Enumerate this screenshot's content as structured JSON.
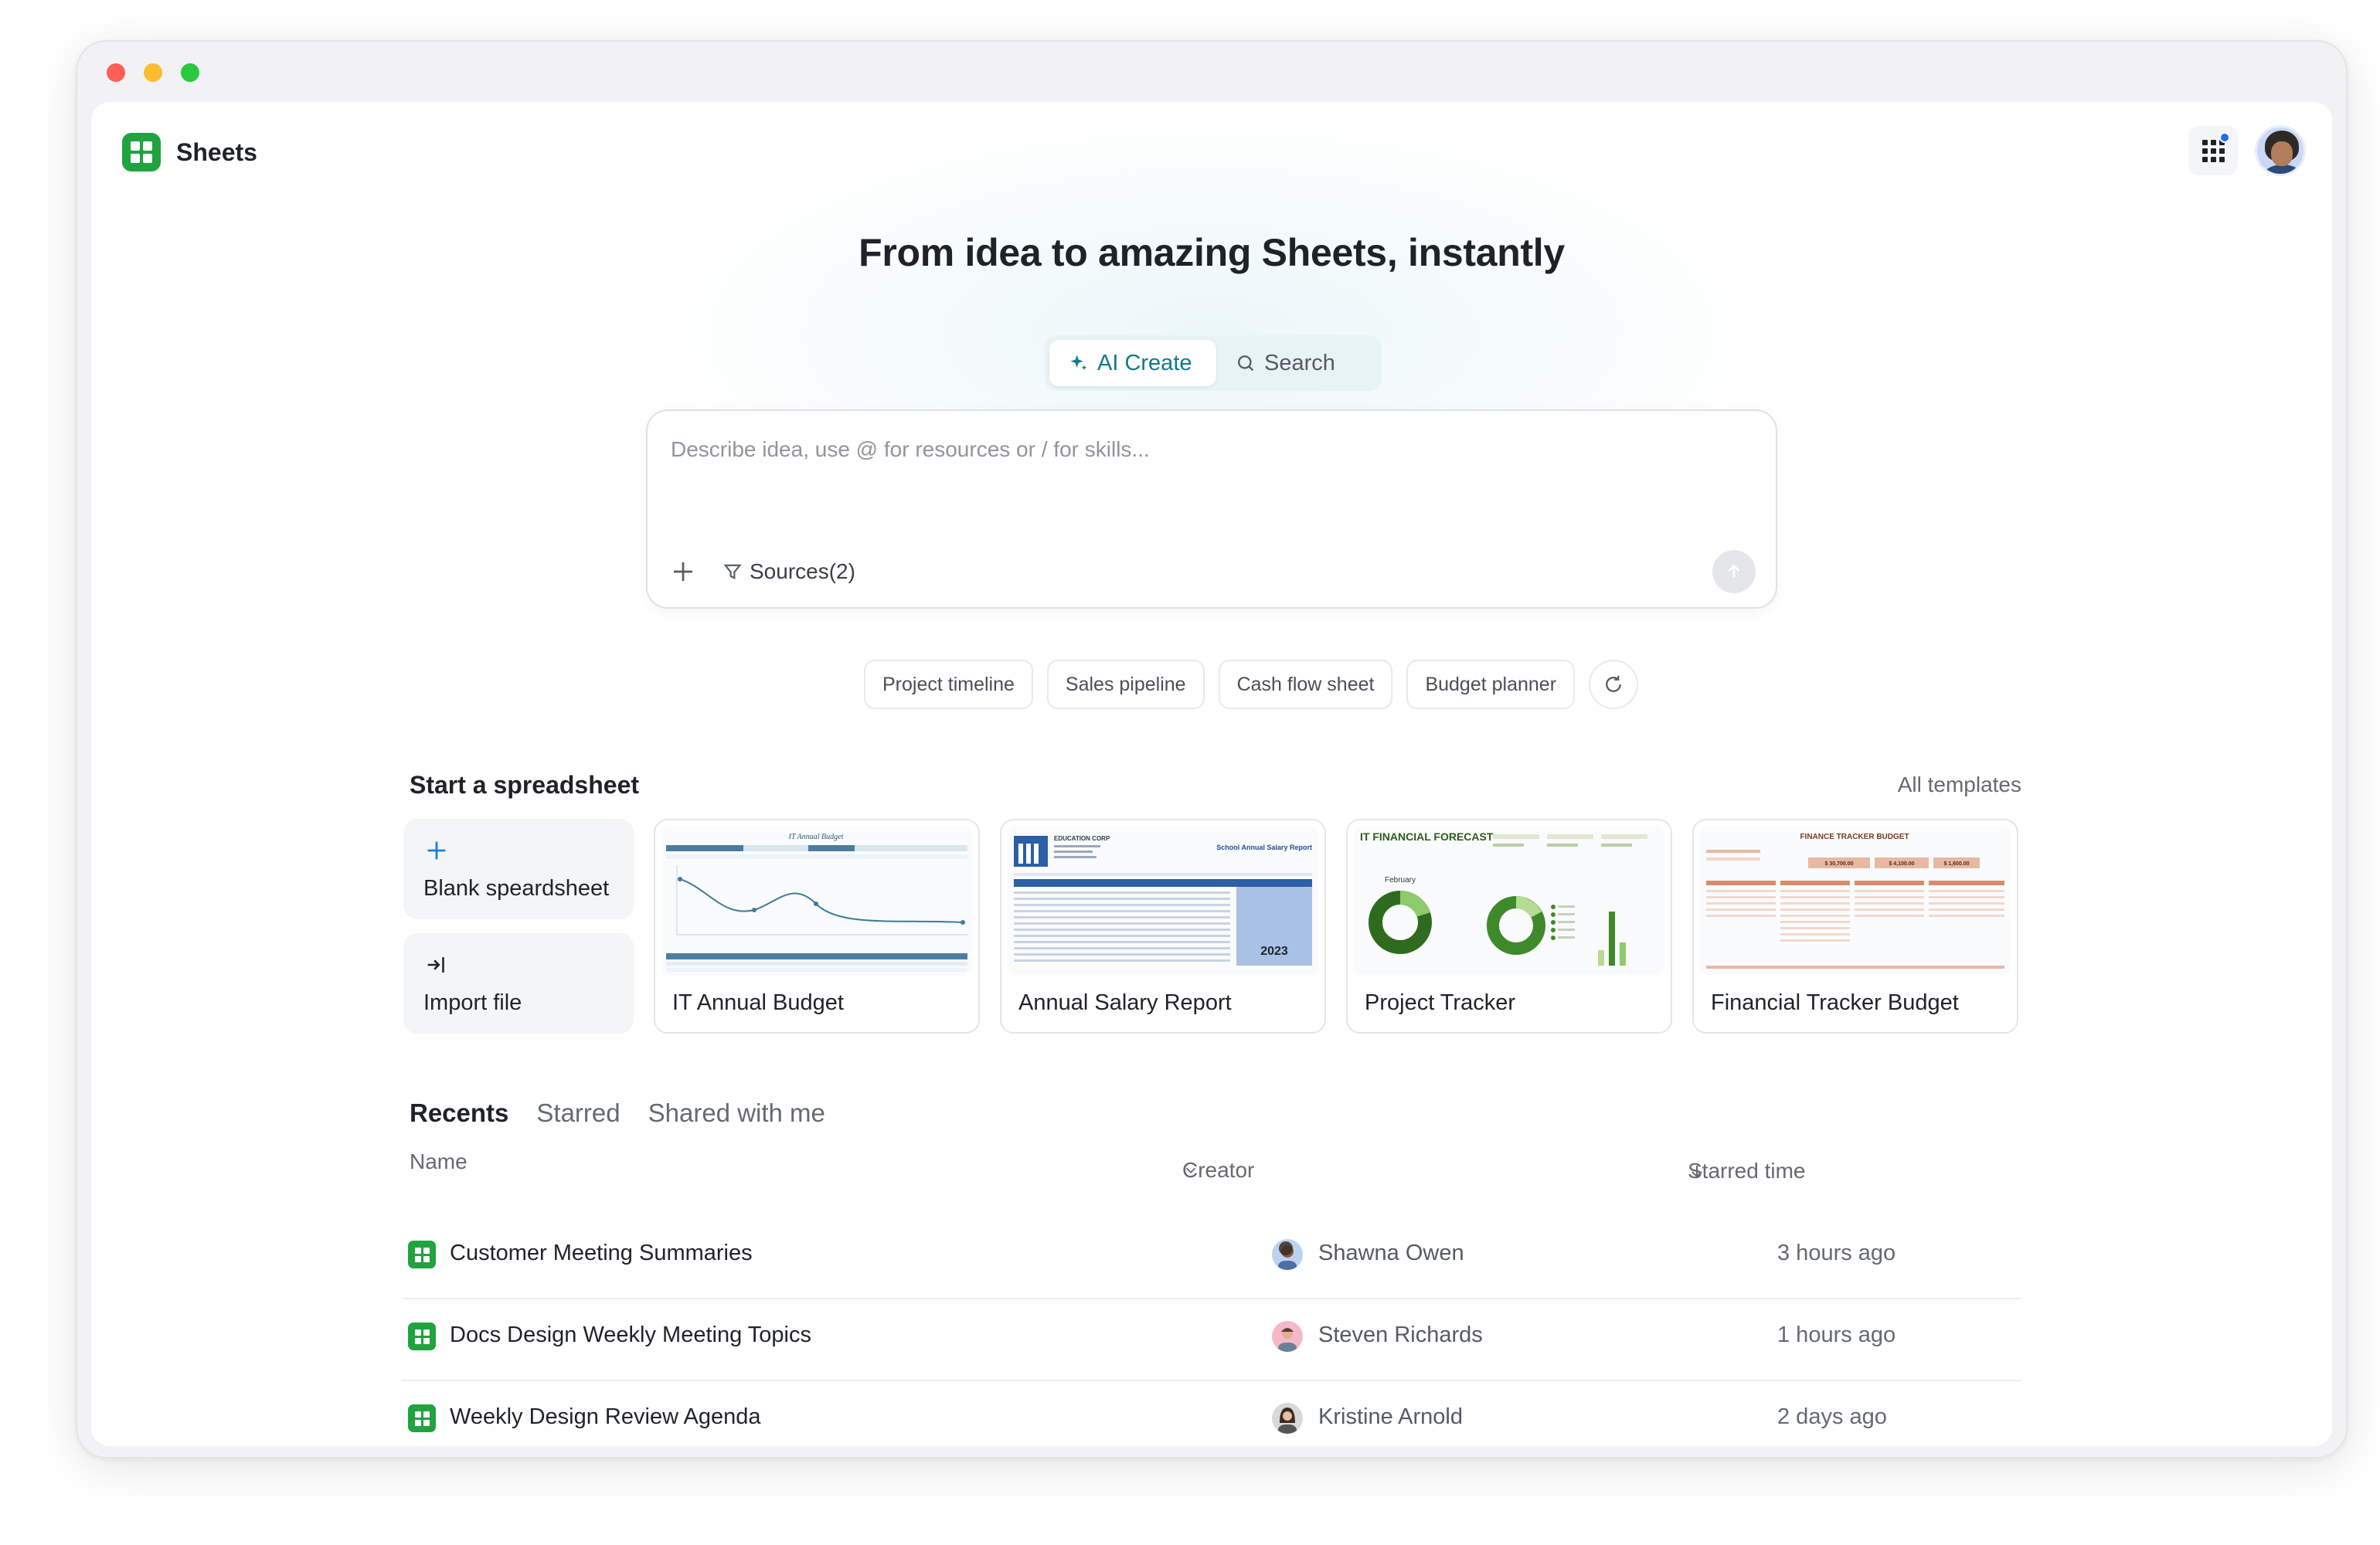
{
  "app": {
    "name": "Sheets"
  },
  "hero": {
    "headline": "From idea to amazing Sheets, instantly",
    "modes": [
      {
        "label": "AI Create",
        "icon": "sparkle-icon",
        "active": true
      },
      {
        "label": "Search",
        "icon": "search-icon",
        "active": false
      }
    ]
  },
  "prompt": {
    "placeholder": "Describe idea, use @ for resources or / for skills...",
    "sources_label": "Sources(2)"
  },
  "suggestions": [
    "Project timeline",
    "Sales pipeline",
    "Cash flow sheet",
    "Budget planner"
  ],
  "start": {
    "title": "Start a spreadsheet",
    "all_templates": "All templates",
    "blank_label": "Blank speardsheet",
    "import_label": "Import file"
  },
  "templates": [
    {
      "name": "IT Annual Budget",
      "thumb_title": "IT Annual Budget"
    },
    {
      "name": "Annual Salary Report",
      "thumb_title": "School Annual Salary Report",
      "thumb_org": "EDUCATION CORP",
      "thumb_year": "2023"
    },
    {
      "name": "Project Tracker",
      "thumb_title": "IT FINANCIAL FORECAST",
      "thumb_month": "February"
    },
    {
      "name": "Financial Tracker Budget",
      "thumb_title": "FINANCE TRACKER BUDGET",
      "thumb_values": [
        "$ 30,700.00",
        "$ 4,100.00",
        "$ 1,600.00"
      ]
    }
  ],
  "recents": {
    "tabs": [
      {
        "label": "Recents",
        "active": true
      },
      {
        "label": "Starred",
        "active": false
      },
      {
        "label": "Shared with me",
        "active": false
      }
    ],
    "columns": {
      "name": "Name",
      "creator": "Creator",
      "time": "Starred time"
    },
    "rows": [
      {
        "name": "Customer Meeting Summaries",
        "creator": "Shawna Owen",
        "time": "3 hours ago"
      },
      {
        "name": "Docs Design Weekly Meeting Topics",
        "creator": "Steven Richards",
        "time": "1 hours ago"
      },
      {
        "name": "Weekly Design Review Agenda",
        "creator": "Kristine Arnold",
        "time": "2 days ago"
      }
    ]
  },
  "colors": {
    "brand_green": "#21a340",
    "accent_teal": "#127a8a",
    "notification_blue": "#1f6bf0"
  }
}
